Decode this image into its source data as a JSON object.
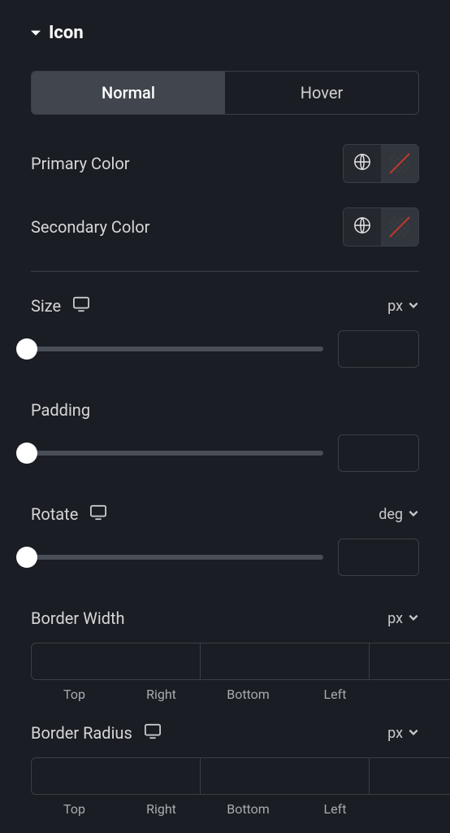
{
  "section": {
    "title": "Icon"
  },
  "tabs": {
    "normal": "Normal",
    "hover": "Hover"
  },
  "labels": {
    "primary_color": "Primary Color",
    "secondary_color": "Secondary Color",
    "size": "Size",
    "padding": "Padding",
    "rotate": "Rotate",
    "border_width": "Border Width",
    "border_radius": "Border Radius"
  },
  "units": {
    "size": "px",
    "rotate": "deg",
    "border_width": "px",
    "border_radius": "px"
  },
  "values": {
    "size": "",
    "padding": "",
    "rotate": "",
    "border_width": {
      "top": "",
      "right": "",
      "bottom": "",
      "left": ""
    },
    "border_radius": {
      "top": "",
      "right": "",
      "bottom": "",
      "left": ""
    }
  },
  "sides": {
    "top": "Top",
    "right": "Right",
    "bottom": "Bottom",
    "left": "Left"
  },
  "icons": {
    "caret": "caret-down-icon",
    "device": "desktop-icon",
    "globe": "globe-icon",
    "chevron": "chevron-down-icon",
    "link": "link-icon"
  }
}
